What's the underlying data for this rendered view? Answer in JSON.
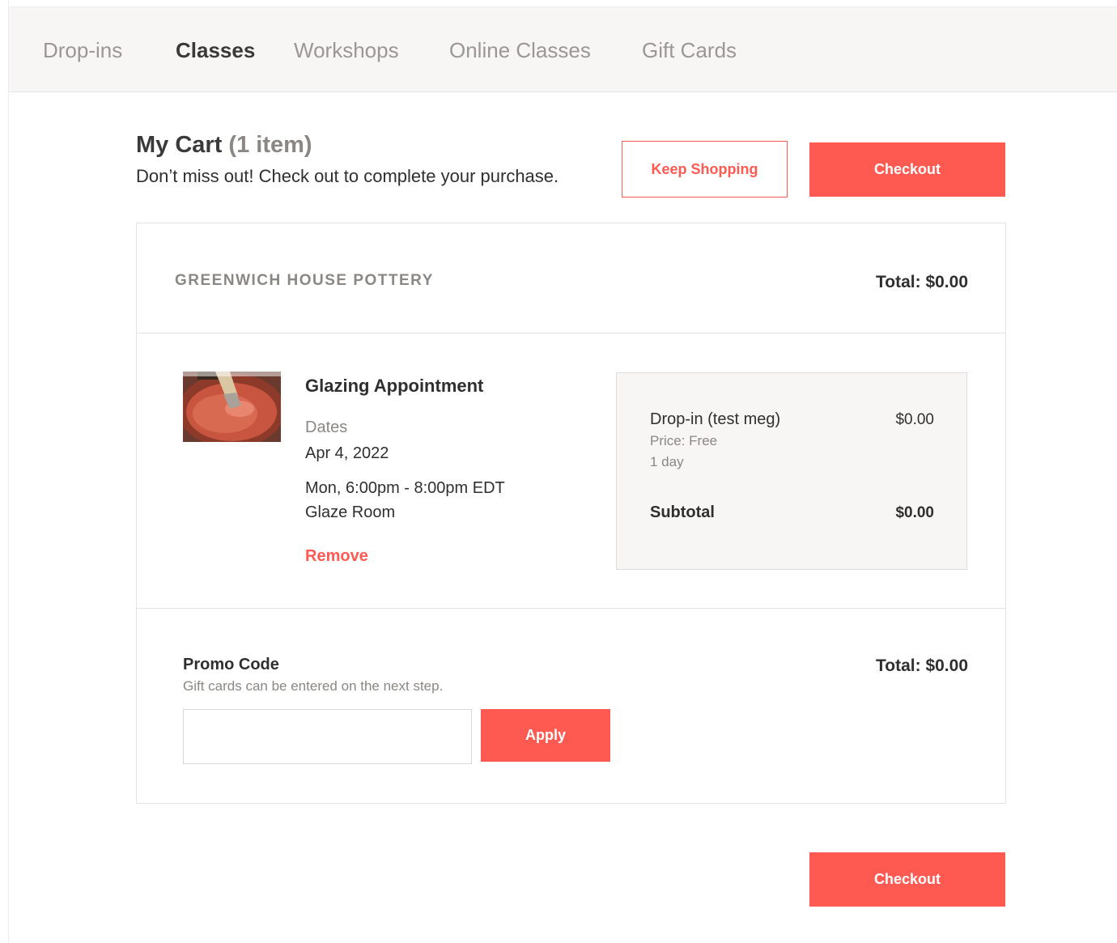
{
  "nav": {
    "tabs": [
      {
        "label": "Drop-ins",
        "active": false
      },
      {
        "label": "Classes",
        "active": true
      },
      {
        "label": "Workshops",
        "active": false
      },
      {
        "label": "Online Classes",
        "active": false
      },
      {
        "label": "Gift Cards",
        "active": false
      }
    ]
  },
  "cart": {
    "title": "My Cart",
    "count": "(1 item)",
    "subtitle": "Don’t miss out! Check out to complete your purchase.",
    "keep_shopping_label": "Keep Shopping",
    "checkout_label": "Checkout"
  },
  "studio": {
    "name": "GREENWICH HOUSE POTTERY",
    "total": "Total: $0.00"
  },
  "item": {
    "title": "Glazing Appointment",
    "dates_label": "Dates",
    "date": "Apr 4, 2022",
    "time": "Mon, 6:00pm - 8:00pm EDT",
    "room": "Glaze Room",
    "remove_label": "Remove"
  },
  "summary": {
    "line_label": "Drop-in (test meg)",
    "line_value": "$0.00",
    "price_text": "Price: Free",
    "duration_text": "1 day",
    "subtotal_label": "Subtotal",
    "subtotal_value": "$0.00"
  },
  "promo": {
    "label": "Promo Code",
    "hint": "Gift cards can be entered on the next step.",
    "input_value": "",
    "apply_label": "Apply",
    "total": "Total: $0.00"
  },
  "colors": {
    "accent": "#ff5a52",
    "nav_bg": "#f7f6f5",
    "muted_text": "#8a8784"
  }
}
